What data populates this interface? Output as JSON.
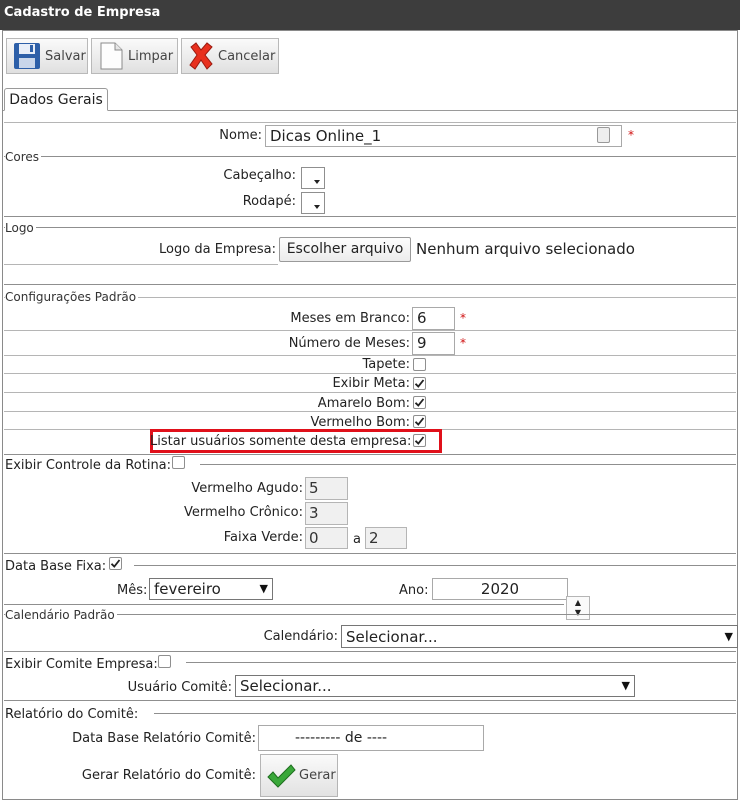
{
  "window": {
    "title": "Cadastro de Empresa"
  },
  "toolbar": {
    "save_label": "Salvar",
    "clear_label": "Limpar",
    "cancel_label": "Cancelar"
  },
  "tabs": [
    {
      "label": "Dados Gerais",
      "active": true
    }
  ],
  "nome": {
    "label": "Nome:",
    "value": "Dicas Online_1",
    "required": "*"
  },
  "cores": {
    "section": "Cores",
    "cabecalho_label": "Cabeçalho:",
    "rodape_label": "Rodapé:"
  },
  "logo": {
    "section": "Logo",
    "label": "Logo da Empresa:",
    "button": "Escolher arquivo",
    "status": "Nenhum arquivo selecionado"
  },
  "config": {
    "section": "Configurações Padrão",
    "meses_branco_label": "Meses em Branco:",
    "meses_branco_value": "6",
    "num_meses_label": "Número de Meses:",
    "num_meses_value": "9",
    "required": "*",
    "tapete_label": "Tapete:",
    "tapete_checked": false,
    "exibir_meta_label": "Exibir Meta:",
    "exibir_meta_checked": true,
    "amarelo_bom_label": "Amarelo Bom:",
    "amarelo_bom_checked": true,
    "vermelho_bom_label": "Vermelho Bom:",
    "vermelho_bom_checked": true,
    "listar_label": "Listar usuários somente desta empresa:",
    "listar_checked": true
  },
  "rotina": {
    "section": "Exibir Controle da Rotina:",
    "checked": false,
    "agudo_label": "Vermelho Agudo:",
    "agudo_value": "5",
    "cronico_label": "Vermelho Crônico:",
    "cronico_value": "3",
    "faixa_label": "Faixa Verde:",
    "faixa_from": "0",
    "faixa_sep": "a",
    "faixa_to": "2"
  },
  "data_base": {
    "section": "Data Base Fixa:",
    "checked": true,
    "mes_label": "Mês:",
    "mes_value": "fevereiro",
    "ano_label": "Ano:",
    "ano_value": "2020"
  },
  "calendario": {
    "section": "Calendário Padrão",
    "label": "Calendário:",
    "value": "Selecionar..."
  },
  "comite": {
    "section": "Exibir Comite Empresa:",
    "checked": false,
    "usuario_label": "Usuário Comitê:",
    "usuario_value": "Selecionar..."
  },
  "relatorio": {
    "section": "Relatório do Comitê:",
    "data_label": "Data Base Relatório Comitê:",
    "data_value": "--------- de ----",
    "gerar_label": "Gerar Relatório do Comitê:",
    "gerar_button": "Gerar"
  },
  "colors": {
    "accent_required": "#d01010",
    "highlight": "#e0101a",
    "titlebar": "#3d3d3d"
  }
}
